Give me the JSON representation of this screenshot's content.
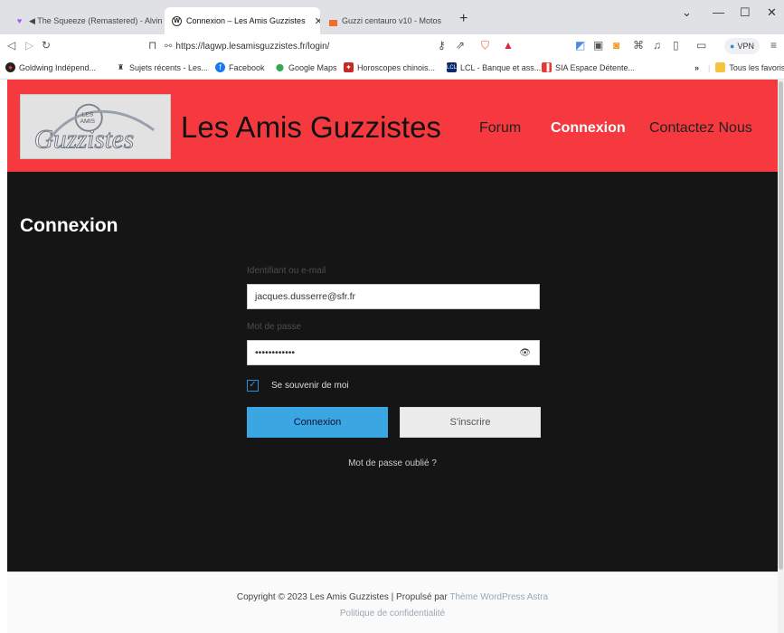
{
  "browser": {
    "tabs": [
      {
        "title": "◀ The Squeeze (Remastered) - Alvin",
        "favicon": "heart-icon",
        "active": false
      },
      {
        "title": "Connexion – Les Amis Guzzistes",
        "favicon": "wordpress-icon",
        "active": true
      },
      {
        "title": "Guzzi centauro v10 - Motos",
        "favicon": "leboncoin-icon",
        "active": false
      }
    ],
    "new_tab": "+",
    "url": "https://lagwp.lesamisguzzistes.fr/login/",
    "vpn_label": "VPN",
    "bookmarks": [
      {
        "label": "Goldwing Indépend...",
        "icon": "shield-icon"
      },
      {
        "label": "Sujets récents - Les...",
        "icon": "rider-icon"
      },
      {
        "label": "Facebook",
        "icon": "facebook-icon"
      },
      {
        "label": "Google Maps",
        "icon": "map-pin-icon"
      },
      {
        "label": "Horoscopes chinois...",
        "icon": "horoscope-icon"
      },
      {
        "label": "LCL - Banque et ass...",
        "icon": "bank-icon"
      },
      {
        "label": "SIA Espace Détente...",
        "icon": "sia-icon"
      }
    ],
    "bookmarks_more": "»",
    "all_bookmarks": "Tous les favoris"
  },
  "site": {
    "title": "Les Amis Guzzistes",
    "nav": [
      {
        "label": "Forum",
        "current": false
      },
      {
        "label": "Connexion",
        "current": true
      },
      {
        "label": "Contactez Nous",
        "current": false
      }
    ],
    "logo": {
      "line1": "LES",
      "line2": "AMIS",
      "script": "Guzzistes"
    }
  },
  "login": {
    "heading": "Connexion",
    "username_label": "Identifiant ou e-mail",
    "username_value": "jacques.dusserre@sfr.fr",
    "password_label": "Mot de passe",
    "password_value": "••••••••••••",
    "remember_label": "Se souvenir de moi",
    "remember_checked": true,
    "submit_label": "Connexion",
    "register_label": "S'inscrire",
    "forgot_label": "Mot de passe oublié ?"
  },
  "footer": {
    "copyright": "Copyright © 2023 Les Amis Guzzistes | Propulsé par ",
    "theme_link": "Thème WordPress Astra",
    "privacy": "Politique de confidentialité"
  },
  "colors": {
    "header_bg": "#f6393f",
    "primary_button": "#3aa7e3",
    "page_bg": "#151515"
  }
}
